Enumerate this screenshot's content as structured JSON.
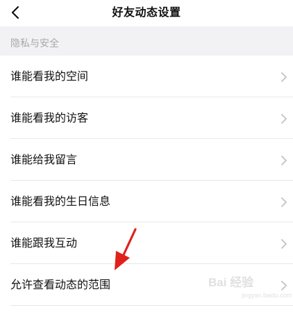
{
  "header": {
    "title": "好友动态设置",
    "back_icon": "chevron-left-icon"
  },
  "section": {
    "label": "隐私与安全"
  },
  "settings": {
    "items": [
      {
        "label": "谁能看我的空间"
      },
      {
        "label": "谁能看我的访客"
      },
      {
        "label": "谁能给我留言"
      },
      {
        "label": "谁能看我的生日信息"
      },
      {
        "label": "谁能跟我互动"
      },
      {
        "label": "允许查看动态的范围"
      }
    ],
    "chevron_icon": "chevron-right-icon"
  },
  "annotation": {
    "arrow_icon": "red-arrow-icon",
    "arrow_color": "#e0201b"
  },
  "watermark": {
    "brand": "Bai 经验",
    "sub": "jingyan.baidu.com"
  },
  "colors": {
    "background": "#f2f2f5",
    "row_background": "#ffffff",
    "text_primary": "#111111",
    "text_secondary": "#a6a6ad",
    "chevron": "#c2c2c7",
    "divider": "#e8e8ea"
  }
}
